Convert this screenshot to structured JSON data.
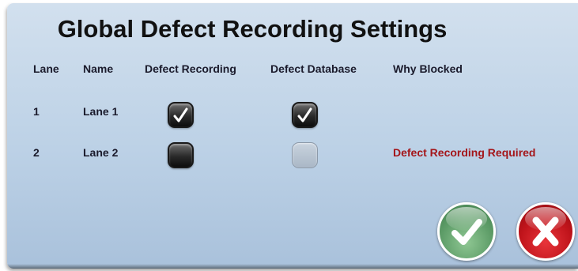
{
  "dialog": {
    "title": "Global Defect Recording Settings"
  },
  "table": {
    "columns": [
      "Lane",
      "Name",
      "Defect Recording",
      "Defect Database",
      "Why Blocked"
    ],
    "rows": [
      {
        "lane": "1",
        "name": "Lane 1",
        "defect_recording": true,
        "defect_database": true,
        "database_enabled": true,
        "why_blocked": ""
      },
      {
        "lane": "2",
        "name": "Lane 2",
        "defect_recording": false,
        "defect_database": false,
        "database_enabled": false,
        "why_blocked": "Defect Recording Required"
      }
    ]
  },
  "buttons": {
    "ok_icon": "checkmark-icon",
    "cancel_icon": "x-icon"
  },
  "colors": {
    "warning_text": "#a4161a",
    "ok_button": "#5e9d68",
    "cancel_button": "#c0141b"
  }
}
